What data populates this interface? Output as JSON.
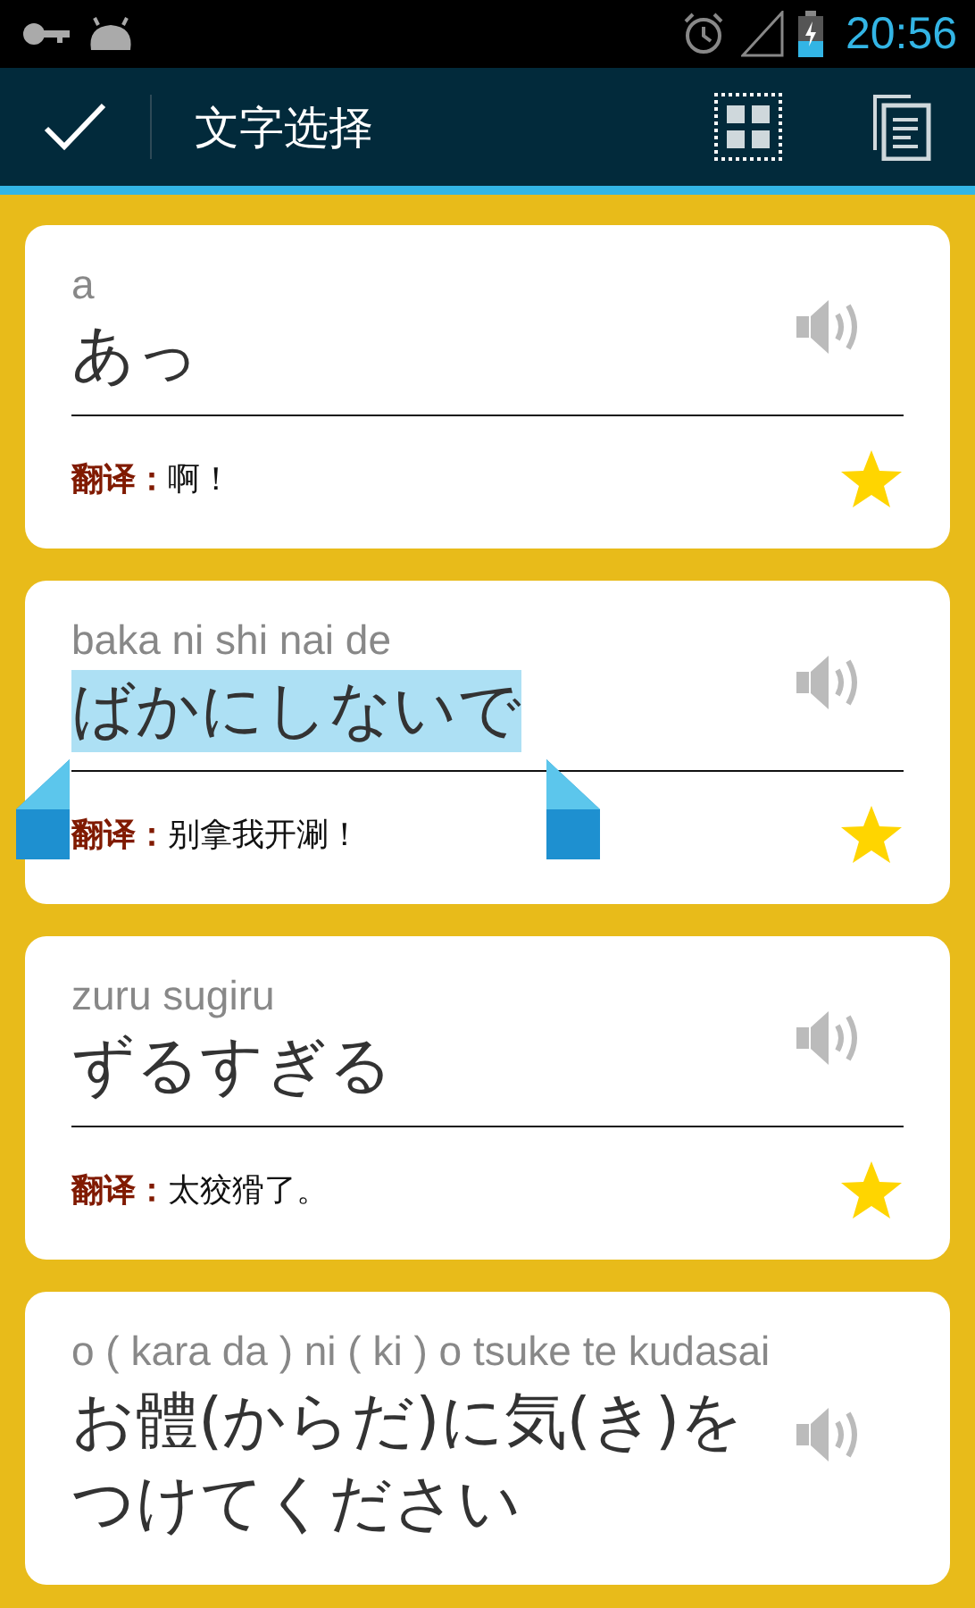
{
  "status_bar": {
    "time": "20:56"
  },
  "action_bar": {
    "title": "文字选择"
  },
  "cards": [
    {
      "romaji": "a",
      "phrase": "あっ",
      "selected": false,
      "translation_label": "翻译：",
      "translation": "啊！",
      "starred": true
    },
    {
      "romaji": "baka ni shi nai de",
      "phrase": "ばかにしないで",
      "selected": true,
      "translation_label": "翻译：",
      "translation": "别拿我开涮！",
      "starred": true
    },
    {
      "romaji": "zuru sugiru",
      "phrase": "ずるすぎる",
      "selected": false,
      "translation_label": "翻译：",
      "translation": "太狡猾了。",
      "starred": true
    },
    {
      "romaji": "o ( kara da ) ni ( ki ) o tsuke te kudasai",
      "phrase": "お體(からだ)に気(き)をつけてください",
      "selected": false
    }
  ]
}
